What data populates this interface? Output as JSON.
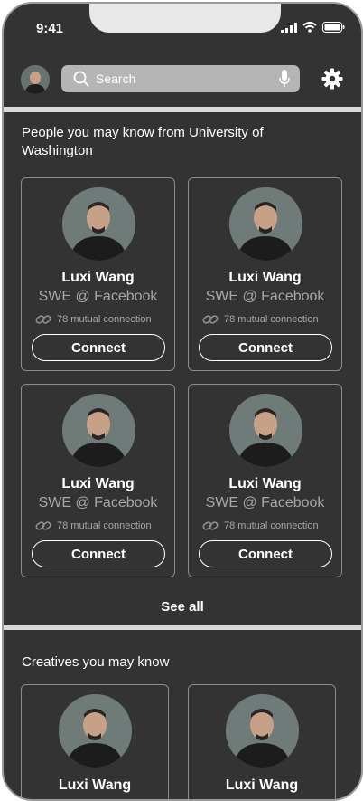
{
  "status_bar": {
    "time": "9:41"
  },
  "header": {
    "search_placeholder": "Search"
  },
  "sections": [
    {
      "title": "People you may know from University of Washington",
      "cards": [
        {
          "name": "Luxi Wang",
          "role": "SWE @ Facebook",
          "mutual": "78 mutual connection",
          "button": "Connect"
        },
        {
          "name": "Luxi Wang",
          "role": "SWE @ Facebook",
          "mutual": "78 mutual connection",
          "button": "Connect"
        },
        {
          "name": "Luxi Wang",
          "role": "SWE @ Facebook",
          "mutual": "78 mutual connection",
          "button": "Connect"
        },
        {
          "name": "Luxi Wang",
          "role": "SWE @ Facebook",
          "mutual": "78 mutual connection",
          "button": "Connect"
        }
      ],
      "see_all": "See all"
    },
    {
      "title": "Creatives you may know",
      "cards": [
        {
          "name": "Luxi Wang"
        },
        {
          "name": "Luxi Wang"
        }
      ]
    }
  ],
  "icons": [
    "avatar",
    "search-icon",
    "mic-icon",
    "gear-icon",
    "link-icon",
    "signal-icon",
    "wifi-icon",
    "battery-icon"
  ]
}
